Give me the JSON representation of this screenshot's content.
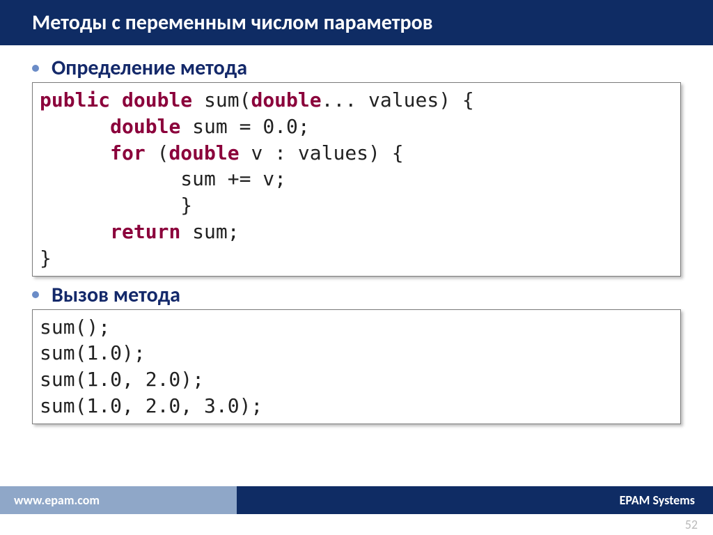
{
  "title": "Методы с переменным числом параметров",
  "bullets": [
    {
      "text": "Определение метода"
    },
    {
      "text": "Вызов метода"
    }
  ],
  "code1": {
    "tokens": [
      {
        "t": "public",
        "c": "kw"
      },
      {
        "t": " ",
        "c": "plain"
      },
      {
        "t": "double",
        "c": "kw"
      },
      {
        "t": " sum(",
        "c": "plain"
      },
      {
        "t": "double",
        "c": "kw"
      },
      {
        "t": "... values) {\n",
        "c": "plain"
      },
      {
        "t": "      ",
        "c": "plain"
      },
      {
        "t": "double",
        "c": "kw"
      },
      {
        "t": " sum = 0.0;\n",
        "c": "plain"
      },
      {
        "t": "      ",
        "c": "plain"
      },
      {
        "t": "for",
        "c": "kw"
      },
      {
        "t": " (",
        "c": "plain"
      },
      {
        "t": "double",
        "c": "kw"
      },
      {
        "t": " v : values) {\n",
        "c": "plain"
      },
      {
        "t": "            sum += v;\n",
        "c": "plain"
      },
      {
        "t": "            }\n",
        "c": "plain"
      },
      {
        "t": "      ",
        "c": "plain"
      },
      {
        "t": "return",
        "c": "kw"
      },
      {
        "t": " sum;\n",
        "c": "plain"
      },
      {
        "t": "}",
        "c": "plain"
      }
    ]
  },
  "code2": {
    "text": "sum();\nsum(1.0);\nsum(1.0, 2.0);\nsum(1.0, 2.0, 3.0);"
  },
  "footer": {
    "left": "www.epam.com",
    "right": "EPAM Systems"
  },
  "pageNumber": "52"
}
